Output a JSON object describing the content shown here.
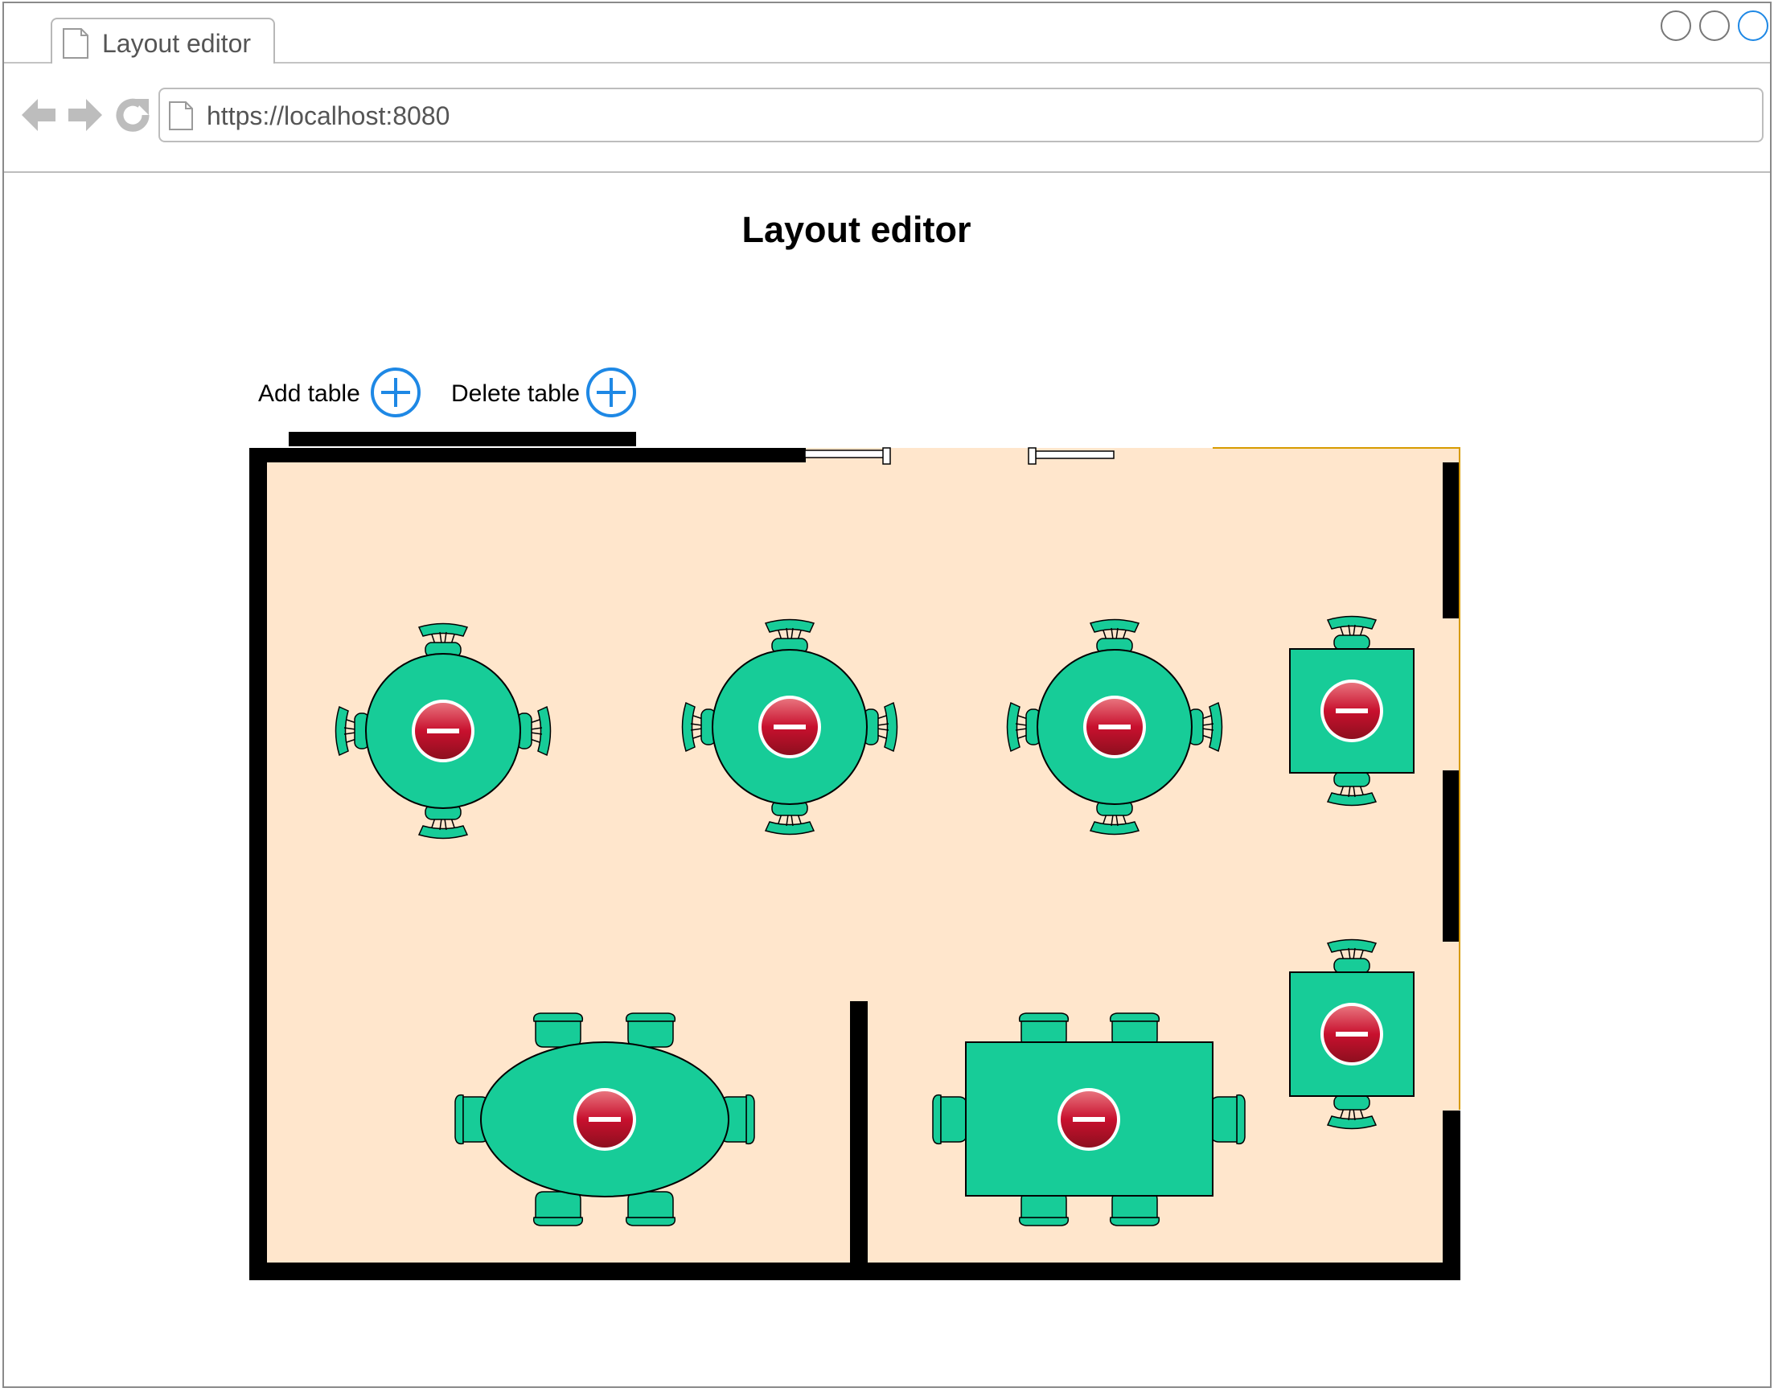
{
  "browser": {
    "tab_title": "Layout editor",
    "url": "https://localhost:8080",
    "window_controls": [
      "minimize-icon",
      "maximize-icon",
      "close-icon"
    ],
    "nav_icons": [
      "back-arrow-icon",
      "forward-arrow-icon",
      "reload-icon"
    ]
  },
  "page": {
    "title": "Layout editor",
    "toolbar": {
      "add_table_label": "Add table",
      "delete_table_label": "Delete table",
      "add_icon": "plus-circle-icon",
      "delete_icon": "plus-circle-icon"
    }
  },
  "floor_plan": {
    "floor_color": "#ffe6cc",
    "wall_color": "#000000",
    "table_color": "#17cc98",
    "delete_badge_color": "#c8102e",
    "tables": [
      {
        "id": "table-1",
        "shape": "round",
        "seats": 4,
        "delete_icon": "minus-circle-icon"
      },
      {
        "id": "table-2",
        "shape": "round",
        "seats": 4,
        "delete_icon": "minus-circle-icon"
      },
      {
        "id": "table-3",
        "shape": "round",
        "seats": 4,
        "delete_icon": "minus-circle-icon"
      },
      {
        "id": "table-4",
        "shape": "square",
        "seats": 2,
        "delete_icon": "minus-circle-icon"
      },
      {
        "id": "table-5",
        "shape": "square",
        "seats": 2,
        "delete_icon": "minus-circle-icon"
      },
      {
        "id": "table-6",
        "shape": "oval",
        "seats": 6,
        "delete_icon": "minus-circle-icon"
      },
      {
        "id": "table-7",
        "shape": "rectangle",
        "seats": 6,
        "delete_icon": "minus-circle-icon"
      }
    ]
  }
}
